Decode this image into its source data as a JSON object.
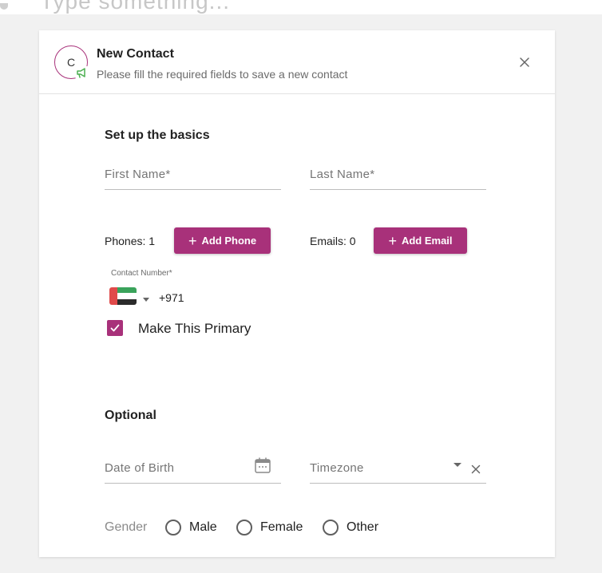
{
  "background": {
    "ghost_text": "Type something..."
  },
  "dialog": {
    "avatar_initial": "C",
    "title": "New Contact",
    "subtitle": "Please fill the required fields to save a new contact",
    "close_icon": "close-icon"
  },
  "basics": {
    "section_title": "Set up the basics",
    "first_name_placeholder": "First Name*",
    "last_name_placeholder": "Last Name*",
    "phones_label": "Phones: 1",
    "add_phone_label": "Add Phone",
    "emails_label": "Emails: 0",
    "add_email_label": "Add Email",
    "contact_number_label": "Contact Number*",
    "dial_code": "+971",
    "flag_icon": "uae-flag-icon",
    "make_primary_label": "Make This Primary",
    "make_primary_checked": true
  },
  "optional": {
    "section_title": "Optional",
    "dob_placeholder": "Date of Birth",
    "timezone_placeholder": "Timezone",
    "gender_label": "Gender",
    "gender_options": [
      "Male",
      "Female",
      "Other"
    ]
  },
  "colors": {
    "accent": "#a8317a",
    "badge_green": "#4caf50"
  }
}
